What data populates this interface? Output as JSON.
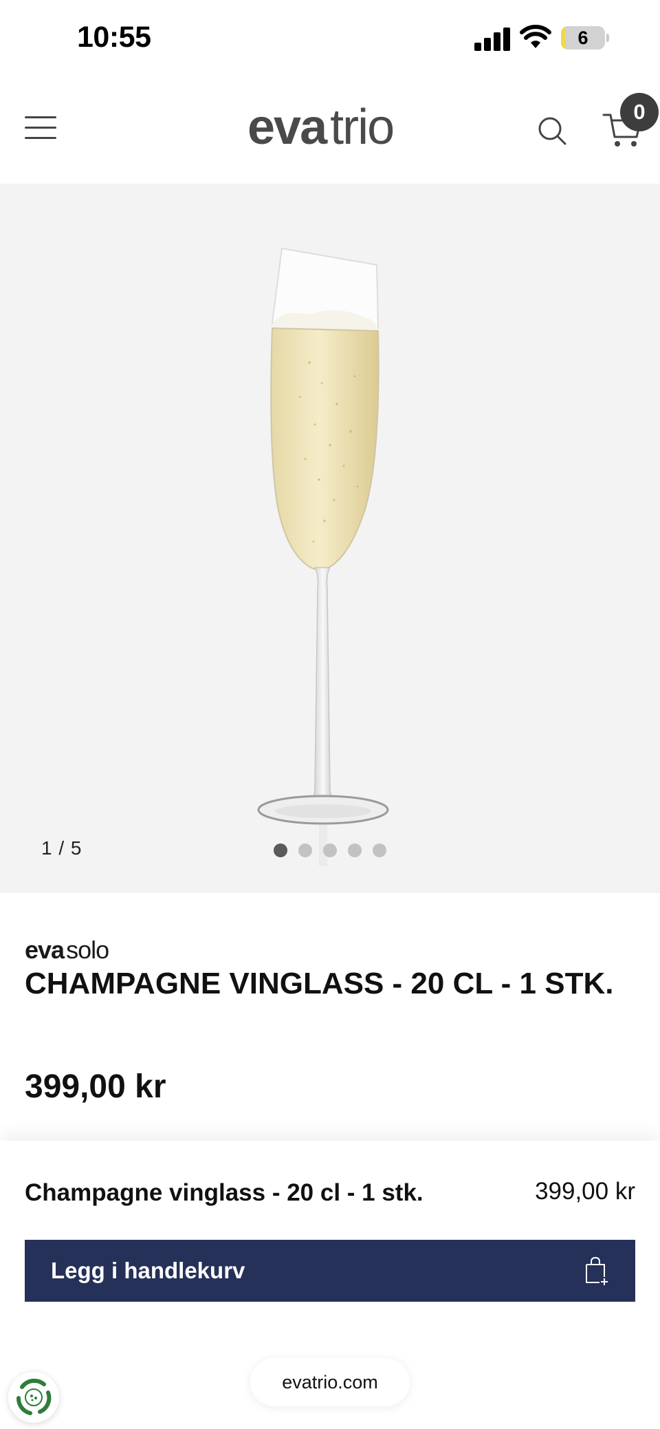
{
  "status_bar": {
    "time": "10:55",
    "battery_level": "6",
    "icons": [
      "cellular-signal-icon",
      "wifi-icon",
      "battery-icon"
    ]
  },
  "header": {
    "logo_bold": "eva",
    "logo_light": "trio",
    "cart_count": "0",
    "icons": [
      "menu-icon",
      "search-icon",
      "cart-icon"
    ]
  },
  "gallery": {
    "counter": "1 / 5",
    "total_images": 5,
    "active_index": 0,
    "background": "#f3f3f3"
  },
  "product": {
    "brand_bold": "eva",
    "brand_light": "solo",
    "title": "CHAMPAGNE VINGLASS - 20 CL - 1 STK.",
    "price": "399,00 kr"
  },
  "sticky_bar": {
    "product_name": "Champagne vinglass - 20 cl - 1 stk.",
    "price": "399,00 kr",
    "add_to_cart_label": "Legg i handlekurv",
    "button_color": "#263159",
    "icons": [
      "shopping-bag-add-icon",
      "eco-badge-icon"
    ]
  },
  "browser": {
    "url": "evatrio.com"
  }
}
